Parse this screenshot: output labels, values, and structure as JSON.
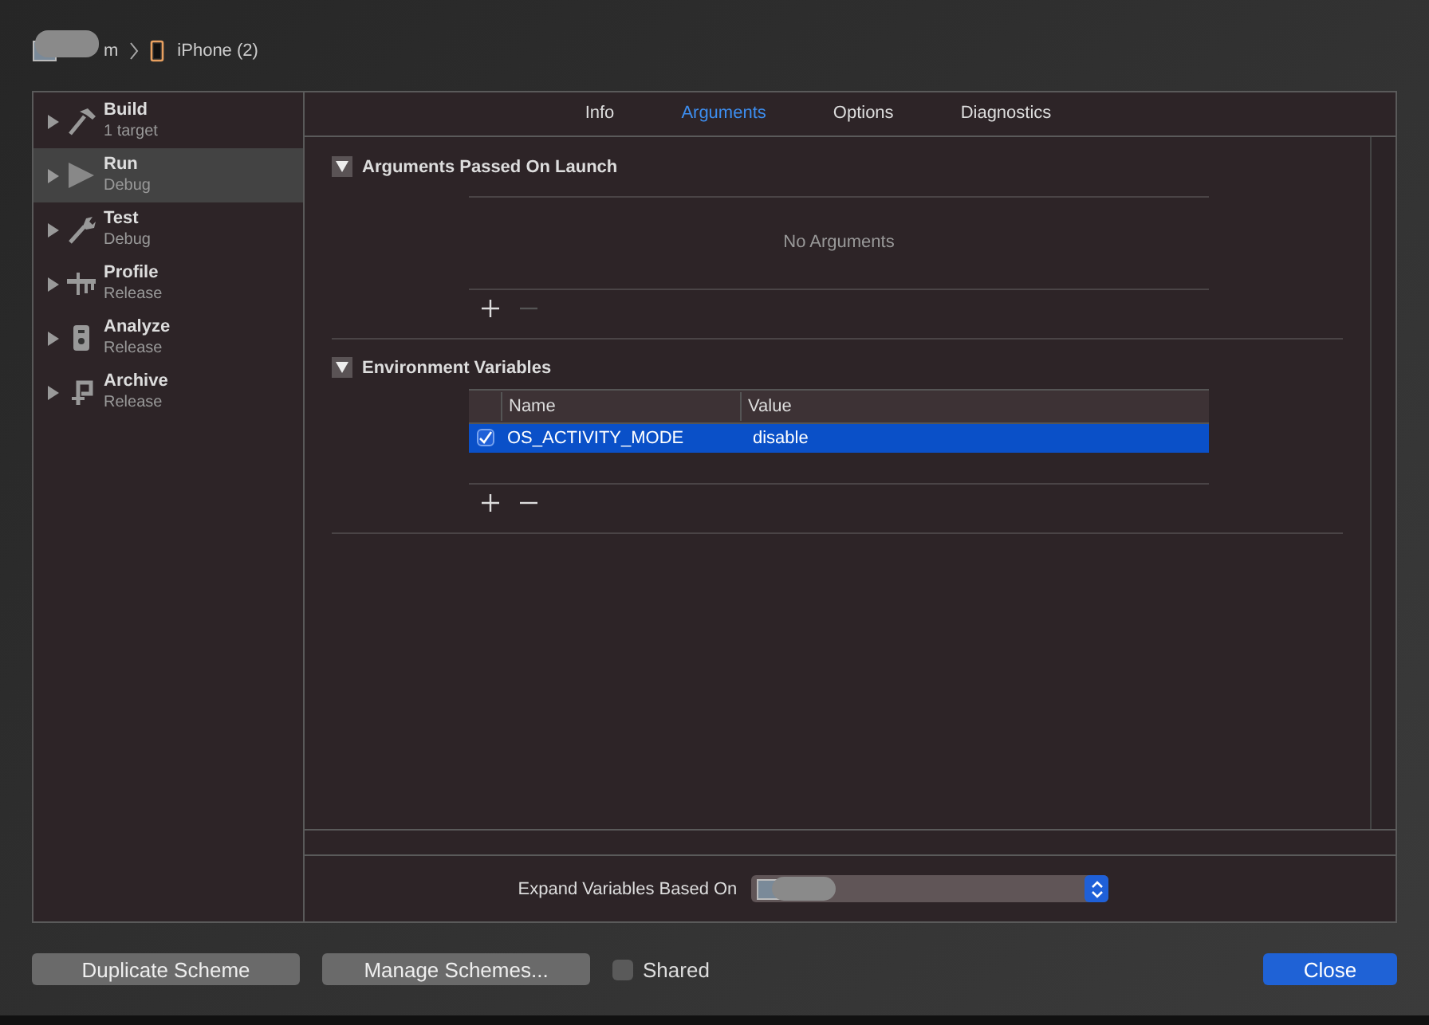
{
  "breadcrumb": {
    "scheme": "m",
    "destination": "iPhone (2)"
  },
  "sidebar": {
    "items": [
      {
        "kind": "build",
        "name": "Build",
        "detail": "1 target",
        "selected": false
      },
      {
        "kind": "run",
        "name": "Run",
        "detail": "Debug",
        "selected": true
      },
      {
        "kind": "test",
        "name": "Test",
        "detail": "Debug",
        "selected": false
      },
      {
        "kind": "profile",
        "name": "Profile",
        "detail": "Release",
        "selected": false
      },
      {
        "kind": "analyze",
        "name": "Analyze",
        "detail": "Release",
        "selected": false
      },
      {
        "kind": "archive",
        "name": "Archive",
        "detail": "Release",
        "selected": false
      }
    ]
  },
  "tabs": [
    {
      "label": "Info",
      "selected": false
    },
    {
      "label": "Arguments",
      "selected": true
    },
    {
      "label": "Options",
      "selected": false
    },
    {
      "label": "Diagnostics",
      "selected": false
    }
  ],
  "sections": [
    {
      "kind": "list",
      "title": "Arguments Passed On Launch",
      "expanded": true,
      "empty_text": "No Arguments",
      "remove_enabled": false
    },
    {
      "kind": "table",
      "title": "Environment Variables",
      "expanded": true,
      "remove_enabled": true,
      "columns": [
        "Name",
        "Value"
      ],
      "rows": [
        {
          "checked": true,
          "selected": true,
          "name": "OS_ACTIVITY_MODE",
          "value": "disable"
        }
      ]
    }
  ],
  "expand_variables": {
    "label": "Expand Variables Based On"
  },
  "footer": {
    "duplicate": "Duplicate Scheme",
    "manage": "Manage Schemes...",
    "shared": {
      "label": "Shared",
      "checked": false
    },
    "close": "Close"
  }
}
